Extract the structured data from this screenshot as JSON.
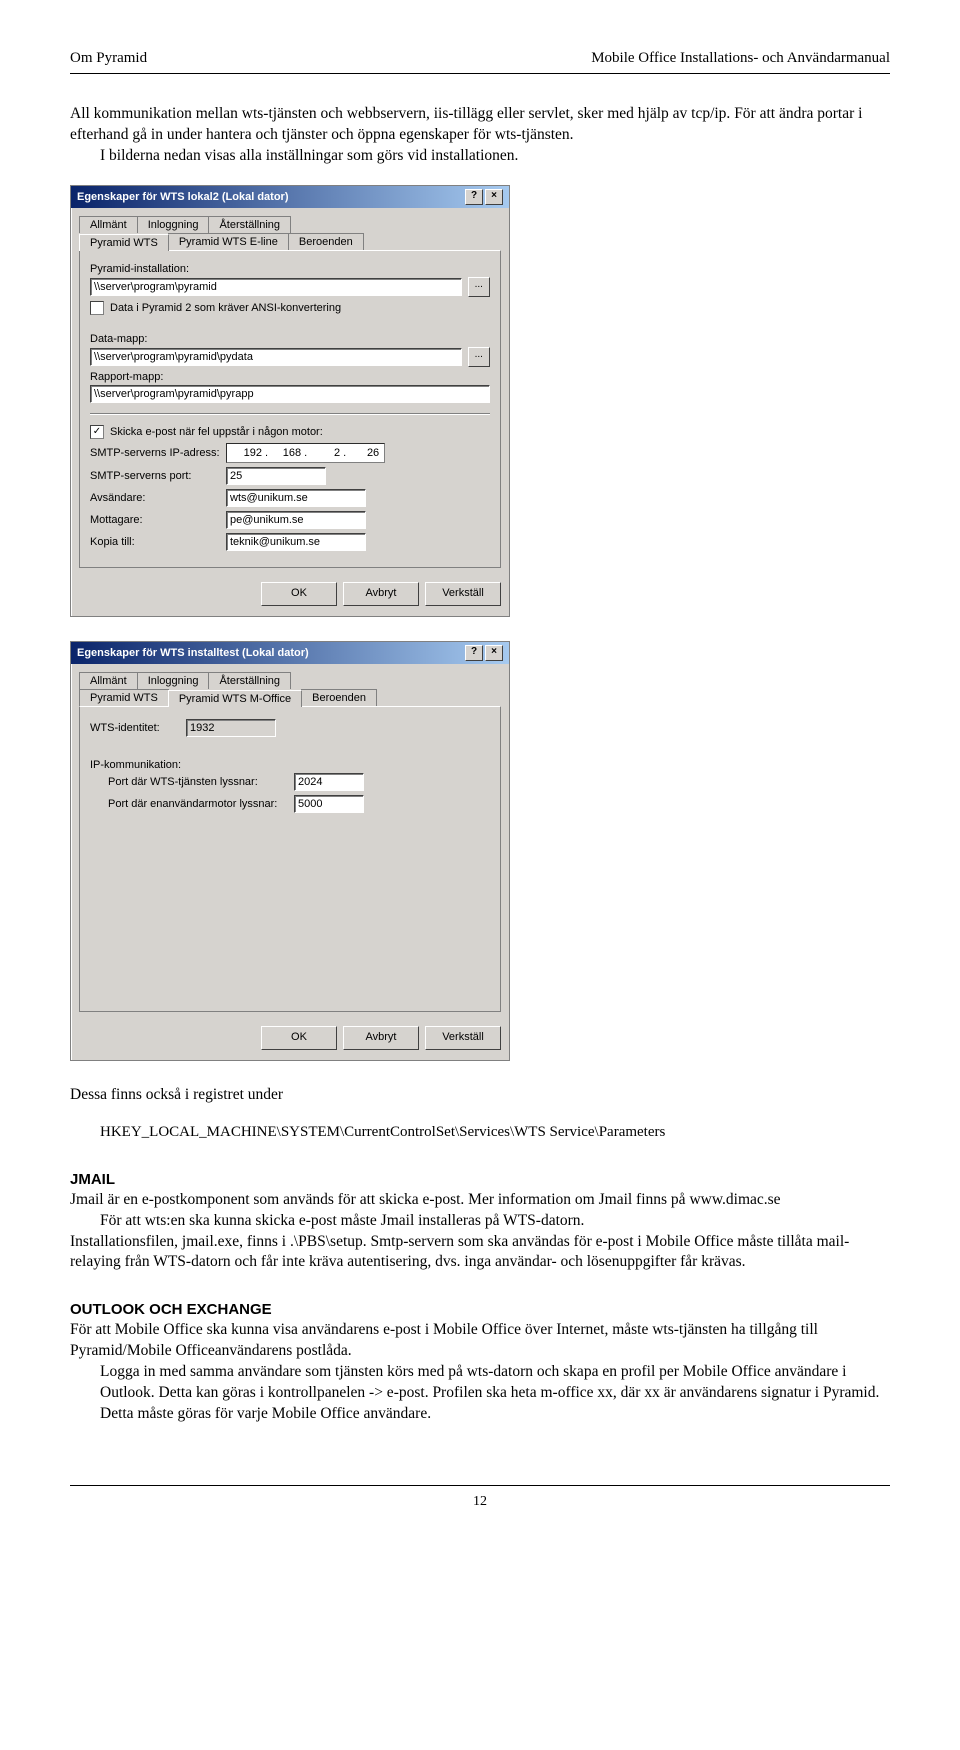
{
  "header": {
    "left": "Om Pyramid",
    "right": "Mobile Office Installations- och Användarmanual"
  },
  "intro": {
    "p1": "All kommunikation mellan wts-tjänsten och webbservern, iis-tillägg eller servlet, sker med hjälp av tcp/ip.",
    "p2": "För att ändra portar i efterhand gå in under hantera och tjänster och öppna egenskaper för wts-tjänsten.",
    "p3": "I bilderna nedan visas alla inställningar som görs vid installationen."
  },
  "dialog1": {
    "title": "Egenskaper för WTS lokal2 (Lokal dator)",
    "tabs_row1": [
      "Allmänt",
      "Inloggning",
      "Återställning"
    ],
    "tabs_row2": [
      "Pyramid WTS",
      "Pyramid WTS E-line",
      "Beroenden"
    ],
    "active_tab": "Pyramid WTS",
    "labels": {
      "install": "Pyramid-installation:",
      "install_val": "\\\\server\\program\\pyramid",
      "ansi": "Data i Pyramid 2 som kräver ANSI-konvertering",
      "datamap": "Data-mapp:",
      "datamap_val": "\\\\server\\program\\pyramid\\pydata",
      "rapport": "Rapport-mapp:",
      "rapport_val": "\\\\server\\program\\pyramid\\pyrapp",
      "send_email": "Skicka e-post när fel uppstår i någon motor:",
      "smtp_ip": "SMTP-serverns IP-adress:",
      "ip1": "192",
      "ip2": "168",
      "ip3": "2",
      "ip4": "26",
      "smtp_port": "SMTP-serverns port:",
      "smtp_port_val": "25",
      "sender": "Avsändare:",
      "sender_val": "wts@unikum.se",
      "recipient": "Mottagare:",
      "recipient_val": "pe@unikum.se",
      "copy": "Kopia till:",
      "copy_val": "teknik@unikum.se"
    },
    "buttons": {
      "ok": "OK",
      "cancel": "Avbryt",
      "apply": "Verkställ"
    }
  },
  "dialog2": {
    "title": "Egenskaper för WTS installtest (Lokal dator)",
    "tabs_row1": [
      "Allmänt",
      "Inloggning",
      "Återställning"
    ],
    "tabs_row2": [
      "Pyramid WTS",
      "Pyramid WTS M-Office",
      "Beroenden"
    ],
    "active_tab": "Pyramid WTS M-Office",
    "labels": {
      "identity": "WTS-identitet:",
      "identity_val": "1932",
      "ipcomm": "IP-kommunikation:",
      "port_wts": "Port där WTS-tjänsten lyssnar:",
      "port_wts_val": "2024",
      "port_single": "Port där enanvändarmotor lyssnar:",
      "port_single_val": "5000"
    },
    "buttons": {
      "ok": "OK",
      "cancel": "Avbryt",
      "apply": "Verkställ"
    }
  },
  "registry": {
    "intro": "Dessa finns också i registret under",
    "path": "HKEY_LOCAL_MACHINE\\SYSTEM\\CurrentControlSet\\Services\\WTS Service\\Parameters"
  },
  "jmail": {
    "heading": "JMAIL",
    "p1": "Jmail är en e-postkomponent som används för att skicka e-post. Mer information om Jmail finns på www.dimac.se",
    "p2": "För att wts:en ska kunna skicka e-post måste Jmail installeras på WTS-datorn.",
    "p3": "Installationsfilen, jmail.exe, finns i .\\PBS\\setup. Smtp-servern som ska användas för e-post i Mobile Office måste tillåta mail-relaying från WTS-datorn och får inte kräva autentisering, dvs. inga användar- och lösenuppgifter får krävas."
  },
  "outlook": {
    "heading": "OUTLOOK OCH EXCHANGE",
    "p1": "För att Mobile Office ska kunna visa användarens e-post i Mobile Office över Internet, måste wts-tjänsten ha tillgång till Pyramid/Mobile Officeanvändarens postlåda.",
    "p2": "Logga in med samma användare som tjänsten körs med på wts-datorn och skapa en profil per Mobile Office användare i Outlook. Detta kan göras i kontrollpanelen -> e-post. Profilen ska heta m-office xx, där xx är användarens signatur i Pyramid. Detta måste göras för varje Mobile Office användare."
  },
  "footer": {
    "page": "12"
  }
}
